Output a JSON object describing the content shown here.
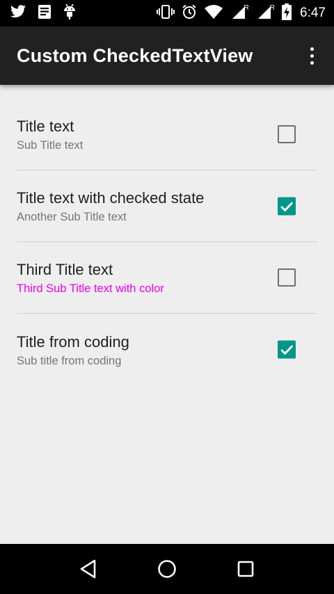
{
  "status_bar": {
    "time": "6:47",
    "left_icons": [
      "twitter-icon",
      "document-icon",
      "android-icon"
    ],
    "right_icons": [
      "vibrate-icon",
      "alarm-icon",
      "wifi-icon",
      "signal-icon",
      "signal-icon",
      "battery-charging-icon"
    ],
    "roaming_marker": "R"
  },
  "app_bar": {
    "title": "Custom CheckedTextView",
    "overflow_icon": "more-vert-icon"
  },
  "items": [
    {
      "title": "Title text",
      "subtitle": "Sub Title text",
      "checked": false,
      "subtitle_color": "#757575"
    },
    {
      "title": "Title text with checked state",
      "subtitle": "Another Sub Title text",
      "checked": true,
      "subtitle_color": "#757575"
    },
    {
      "title": "Third Title text",
      "subtitle": "Third Sub Title text with color",
      "checked": false,
      "subtitle_color": "#ee00ee"
    },
    {
      "title": "Title from coding",
      "subtitle": "Sub title from coding",
      "checked": true,
      "subtitle_color": "#757575"
    }
  ],
  "nav_bar": {
    "buttons": [
      "back-icon",
      "home-icon",
      "recents-icon"
    ]
  },
  "colors": {
    "accent": "#009688",
    "app_bar": "#212121",
    "background": "#eeeeee"
  }
}
